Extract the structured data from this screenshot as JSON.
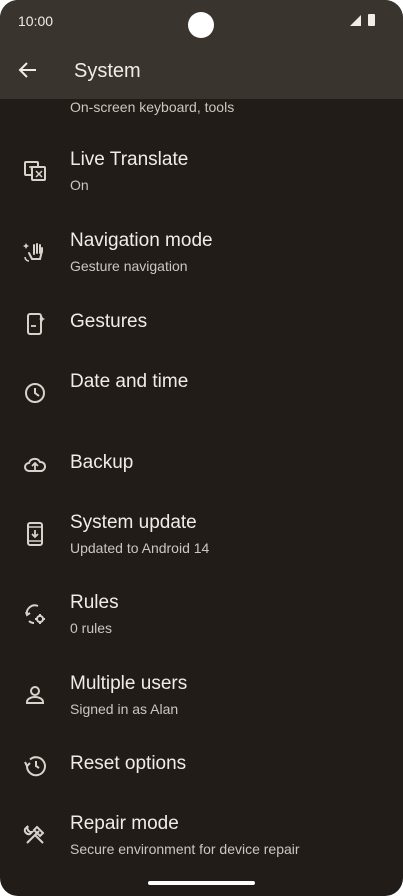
{
  "status_bar": {
    "time": "10:00"
  },
  "app_bar": {
    "title": "System"
  },
  "partial_item": {
    "subtitle": "On-screen keyboard, tools"
  },
  "items": [
    {
      "title": "Live Translate",
      "subtitle": "On",
      "icon": "translate-icon"
    },
    {
      "title": "Navigation mode",
      "subtitle": "Gesture navigation",
      "icon": "gesture-hand-icon"
    },
    {
      "title": "Gestures",
      "subtitle": "",
      "icon": "phone-gesture-icon"
    },
    {
      "title": "Date and time",
      "subtitle": "",
      "icon": "clock-icon"
    },
    {
      "title": "Backup",
      "subtitle": "",
      "icon": "cloud-upload-icon"
    },
    {
      "title": "System update",
      "subtitle": "Updated to Android 14",
      "icon": "system-update-icon"
    },
    {
      "title": "Rules",
      "subtitle": "0 rules",
      "icon": "rules-icon"
    },
    {
      "title": "Multiple users",
      "subtitle": "Signed in as Alan",
      "icon": "person-icon"
    },
    {
      "title": "Reset options",
      "subtitle": "",
      "icon": "history-icon"
    },
    {
      "title": "Repair mode",
      "subtitle": "Secure environment for device repair",
      "icon": "tools-icon"
    }
  ]
}
